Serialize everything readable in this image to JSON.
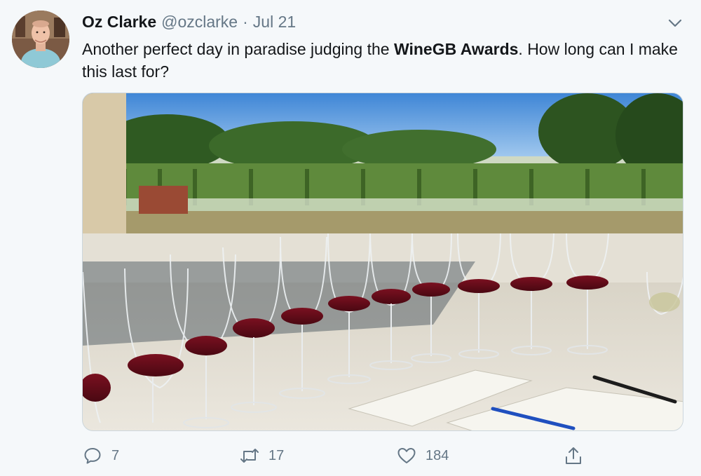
{
  "author": {
    "name": "Oz Clarke",
    "handle": "@ozclarke",
    "separator": "·",
    "date": "Jul 21"
  },
  "tweet": {
    "text_before": "Another perfect day in paradise judging the ",
    "text_bold": "WineGB Awards",
    "text_after": ".  How long can I make this last for?"
  },
  "actions": {
    "reply_count": "7",
    "retweet_count": "17",
    "like_count": "184"
  },
  "icons": {
    "caret": "chevron-down-icon",
    "reply": "reply-icon",
    "retweet": "retweet-icon",
    "like": "heart-icon",
    "share": "share-icon"
  },
  "colors": {
    "text_primary": "#14171a",
    "text_secondary": "#657786",
    "background": "#f5f8fa"
  }
}
